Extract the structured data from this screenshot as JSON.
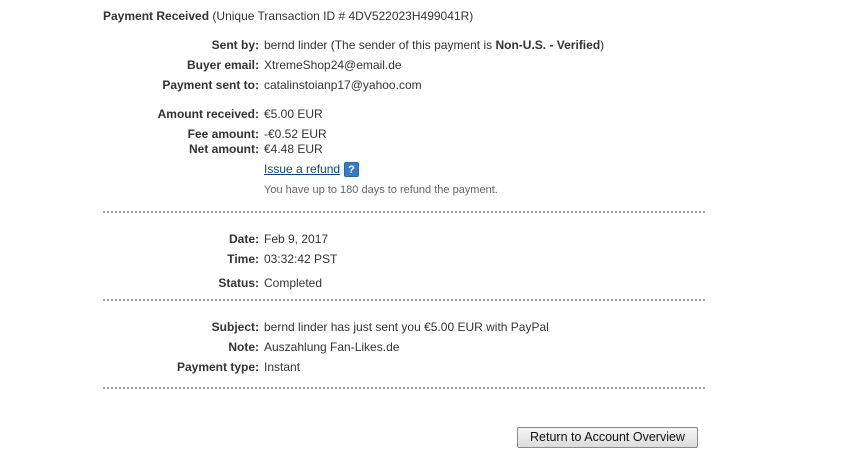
{
  "header": {
    "title": "Payment Received",
    "transaction": "(Unique Transaction ID # 4DV522023H499041R)"
  },
  "payer": {
    "sent_by_label": "Sent by:",
    "sent_by_name": "bernd linder",
    "sent_by_prefix": "(The sender of this payment is ",
    "sent_by_status": "Non-U.S. - Verified",
    "sent_by_suffix": ")",
    "buyer_email_label": "Buyer email:",
    "buyer_email": "XtremeShop24@email.de",
    "sent_to_label": "Payment sent to:",
    "sent_to": "catalinstoianp17@yahoo.com"
  },
  "amounts": {
    "received_label": "Amount received:",
    "received": "€5.00 EUR",
    "fee_label": "Fee amount:",
    "fee": "-€0.52 EUR",
    "net_label": "Net amount:",
    "net": "€4.48 EUR",
    "refund_link": "Issue a refund",
    "help_icon": "?",
    "refund_note": "You have up to 180 days to refund the payment."
  },
  "details": {
    "date_label": "Date:",
    "date": "Feb 9, 2017",
    "time_label": "Time:",
    "time": "03:32:42 PST",
    "status_label": "Status:",
    "status": "Completed"
  },
  "message": {
    "subject_label": "Subject:",
    "subject": "bernd linder has just sent you €5.00 EUR with PayPal",
    "note_label": "Note:",
    "note": "Auszahlung Fan-Likes.de",
    "payment_type_label": "Payment type:",
    "payment_type": "Instant"
  },
  "actions": {
    "return_button": "Return to Account Overview"
  }
}
